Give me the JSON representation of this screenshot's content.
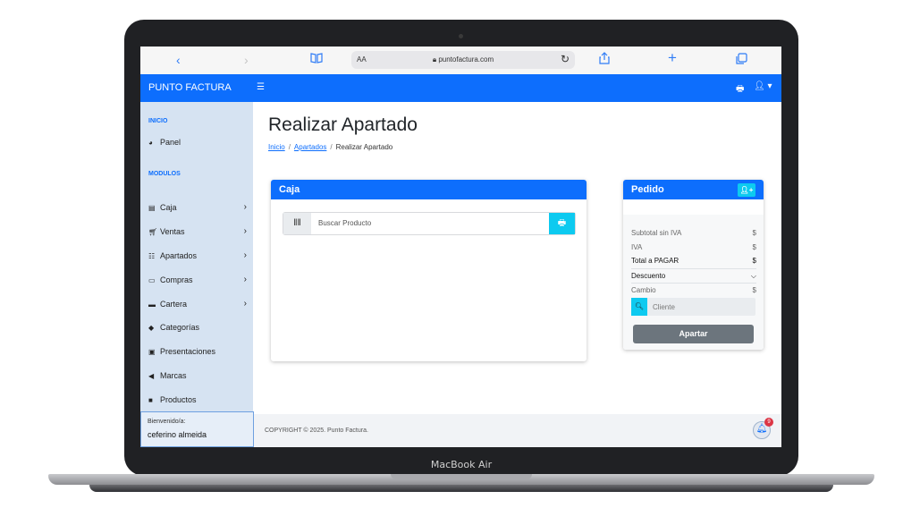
{
  "device": {
    "label": "MacBook Air"
  },
  "browser": {
    "text_size_label": "AA",
    "url": "puntofactura.com",
    "icons": [
      "back-icon",
      "forward-icon",
      "bookmarks-icon",
      "lock-icon",
      "reload-icon",
      "share-icon",
      "new-tab-icon",
      "tabs-icon"
    ]
  },
  "topnav": {
    "brand": "PUNTO FACTURA"
  },
  "sidebar": {
    "section_inicio": "INICIO",
    "panel": "Panel",
    "section_modulos": "MODULOS",
    "items": [
      {
        "label": "Caja",
        "icon": "register-icon",
        "chevron": true
      },
      {
        "label": "Ventas",
        "icon": "cart-icon",
        "chevron": true
      },
      {
        "label": "Apartados",
        "icon": "boxes-icon",
        "chevron": true
      },
      {
        "label": "Compras",
        "icon": "purchases-icon",
        "chevron": true
      },
      {
        "label": "Cartera",
        "icon": "wallet-icon",
        "chevron": true
      },
      {
        "label": "Categorías",
        "icon": "tag-icon",
        "chevron": false
      },
      {
        "label": "Presentaciones",
        "icon": "archive-icon",
        "chevron": false
      },
      {
        "label": "Marcas",
        "icon": "megaphone-icon",
        "chevron": false
      },
      {
        "label": "Productos",
        "icon": "bag-icon",
        "chevron": false
      }
    ],
    "welcome": "Bienvenido/a:",
    "username": "ceferino almeida"
  },
  "main": {
    "title": "Realizar Apartado",
    "breadcrumb": {
      "home": "Inicio",
      "section": "Apartados",
      "current": "Realizar Apartado"
    }
  },
  "caja": {
    "header": "Caja",
    "search_placeholder": "Buscar Producto"
  },
  "pedido": {
    "header": "Pedido",
    "subtotal_label": "Subtotal sin IVA",
    "subtotal_value": "$",
    "iva_label": "IVA",
    "iva_value": "$",
    "total_label": "Total a PAGAR",
    "total_value": "$",
    "descuento_label": "Descuento",
    "cambio_label": "Cambio",
    "cambio_value": "$",
    "cliente_placeholder": "Cliente",
    "apartar_label": "Apartar"
  },
  "footer": {
    "copyright": "COPYRIGHT © 2025. Punto Factura."
  },
  "notifications": {
    "count": "9"
  },
  "colors": {
    "primary": "#0d6efd",
    "info": "#0dcaf0",
    "sidebar_bg": "#d6e3f2",
    "secondary": "#6c757d",
    "danger": "#dc3545"
  }
}
